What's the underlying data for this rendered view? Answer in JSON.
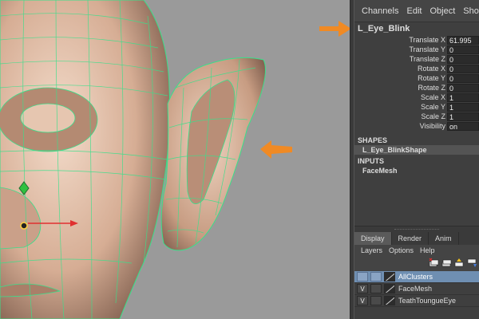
{
  "channel_box": {
    "menu": [
      "Channels",
      "Edit",
      "Object",
      "Show"
    ],
    "object_name": "L_Eye_Blink",
    "attributes": [
      {
        "label": "Translate X",
        "value": "61.995"
      },
      {
        "label": "Translate Y",
        "value": "0"
      },
      {
        "label": "Translate Z",
        "value": "0"
      },
      {
        "label": "Rotate X",
        "value": "0"
      },
      {
        "label": "Rotate Y",
        "value": "0"
      },
      {
        "label": "Rotate Z",
        "value": "0"
      },
      {
        "label": "Scale X",
        "value": "1"
      },
      {
        "label": "Scale Y",
        "value": "1"
      },
      {
        "label": "Scale Z",
        "value": "1"
      },
      {
        "label": "Visibility",
        "value": "on"
      }
    ],
    "shapes_header": "SHAPES",
    "shape_item": "L_Eye_BlinkShape",
    "inputs_header": "INPUTS",
    "input_item": "FaceMesh"
  },
  "layer_editor": {
    "tabs": [
      "Display",
      "Render",
      "Anim"
    ],
    "active_tab": "Display",
    "menu": [
      "Layers",
      "Options",
      "Help"
    ],
    "layers": [
      {
        "v": "",
        "name": "AllClusters",
        "selected": true
      },
      {
        "v": "V",
        "name": "FaceMesh",
        "selected": false
      },
      {
        "v": "V",
        "name": "TeathToungueEye",
        "selected": false
      }
    ]
  },
  "colors": {
    "arrow": "#f08a24",
    "wireframe": "#39e08a",
    "skin": "#e2bfa8",
    "selected_layer": "#6f8fb2"
  },
  "icons": [
    "new-layer-icon",
    "new-selected-layer-icon",
    "move-up-icon",
    "move-down-icon"
  ]
}
